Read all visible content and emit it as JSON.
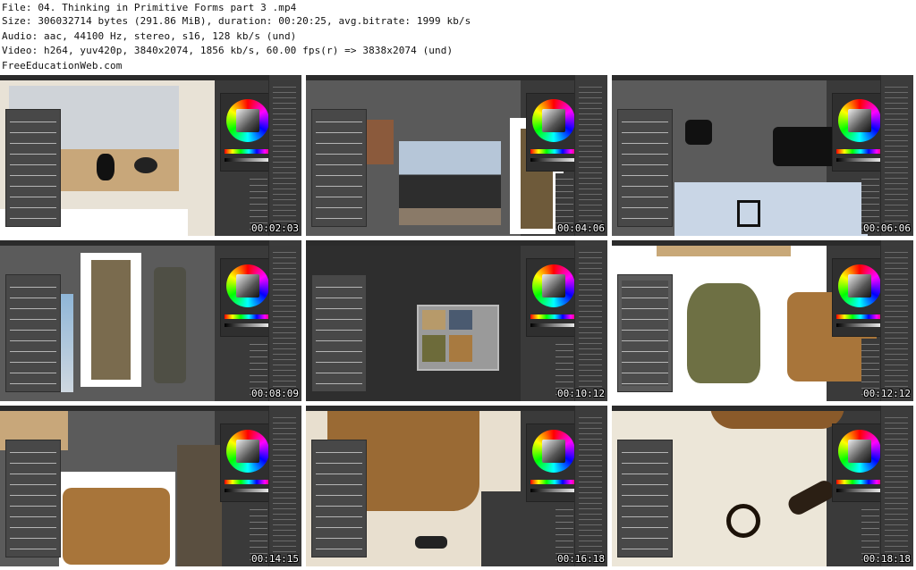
{
  "header": {
    "line1": "File: 04. Thinking in Primitive Forms part 3 .mp4",
    "line2": "Size: 306032714 bytes (291.86 MiB), duration: 00:20:25, avg.bitrate: 1999 kb/s",
    "line3": "Audio: aac, 44100 Hz, stereo, s16, 128 kb/s (und)",
    "line4": "Video: h264, yuv420p, 3840x2074, 1856 kb/s, 60.00 fps(r) => 3838x2074 (und)",
    "line5": "FreeEducationWeb.com"
  },
  "tiles": [
    {
      "timestamp": "00:02:03"
    },
    {
      "timestamp": "00:04:06"
    },
    {
      "timestamp": "00:06:06"
    },
    {
      "timestamp": "00:08:09"
    },
    {
      "timestamp": "00:10:12"
    },
    {
      "timestamp": "00:12:12"
    },
    {
      "timestamp": "00:14:15"
    },
    {
      "timestamp": "00:16:18"
    },
    {
      "timestamp": "00:18:18"
    }
  ],
  "colors": {
    "panel_dark": "#3a3a3a",
    "canvas_gray": "#5b5b5b",
    "timestamp_text": "#ffffff"
  }
}
